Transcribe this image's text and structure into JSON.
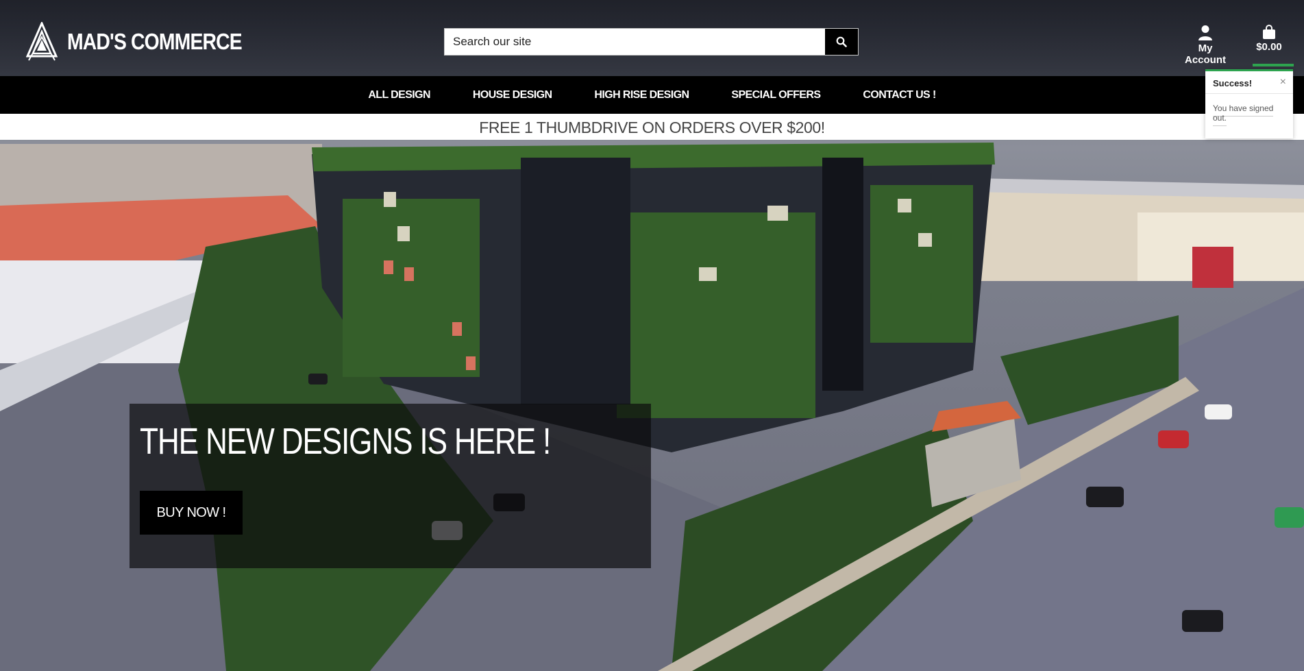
{
  "brand": {
    "name": "MAD'S COMMERCE",
    "logo_icon": "stacked-triangle-logo"
  },
  "search": {
    "placeholder": "Search our site",
    "icon": "search-icon"
  },
  "account": {
    "label": "My Account",
    "icon": "user-icon"
  },
  "cart": {
    "total": "$0.00",
    "icon": "shopping-bag-icon"
  },
  "nav": {
    "items": [
      {
        "label": "ALL DESIGN"
      },
      {
        "label": "HOUSE DESIGN"
      },
      {
        "label": "HIGH RISE DESIGN"
      },
      {
        "label": "SPECIAL OFFERS"
      },
      {
        "label": "CONTACT US !"
      }
    ]
  },
  "promo": {
    "text": "FREE 1 THUMBDRIVE ON ORDERS OVER $200!"
  },
  "toast": {
    "title": "Success!",
    "message": "You have signed out.",
    "close": "×"
  },
  "hero": {
    "headline": "THE NEW DESIGNS IS HERE !",
    "cta": "BUY NOW !"
  },
  "colors": {
    "nav_bg": "#000000",
    "success": "#2ea44f",
    "text_light": "#ffffff"
  }
}
